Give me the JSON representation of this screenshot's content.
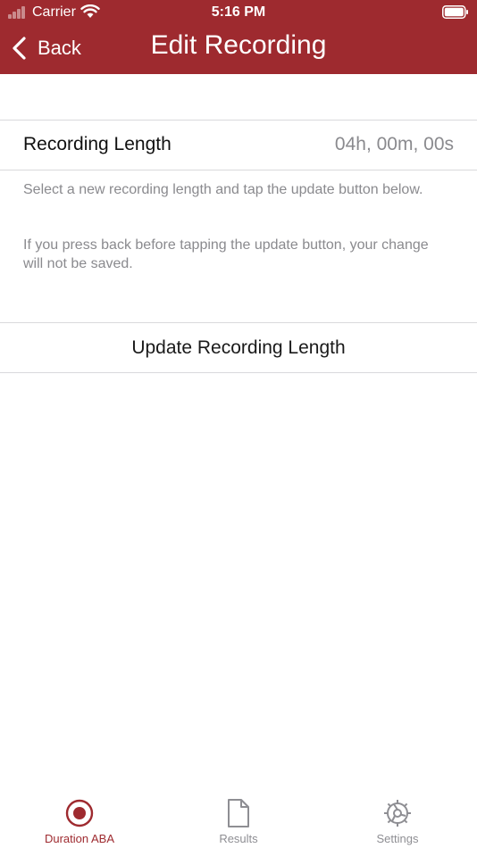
{
  "status_bar": {
    "carrier": "Carrier",
    "time": "5:16 PM"
  },
  "nav": {
    "back_label": "Back",
    "title": "Edit Recording",
    "bar_color": "#9e2a2f"
  },
  "recording_length": {
    "label": "Recording Length",
    "value": "04h, 00m, 00s"
  },
  "help_text": {
    "line1": "Select a new recording length and tap the update button below.",
    "line2": "If you press back before tapping the update button, your change will not be saved."
  },
  "update_button": {
    "label": "Update Recording Length"
  },
  "tabs": [
    {
      "label": "Duration ABA",
      "icon": "record-icon",
      "selected": true
    },
    {
      "label": "Results",
      "icon": "document-icon",
      "selected": false
    },
    {
      "label": "Settings",
      "icon": "gear-icon",
      "selected": false
    }
  ],
  "colors": {
    "accent": "#9e2a2f",
    "inactive_tab": "#8e8e93",
    "secondary_text": "#8a8a8e"
  }
}
